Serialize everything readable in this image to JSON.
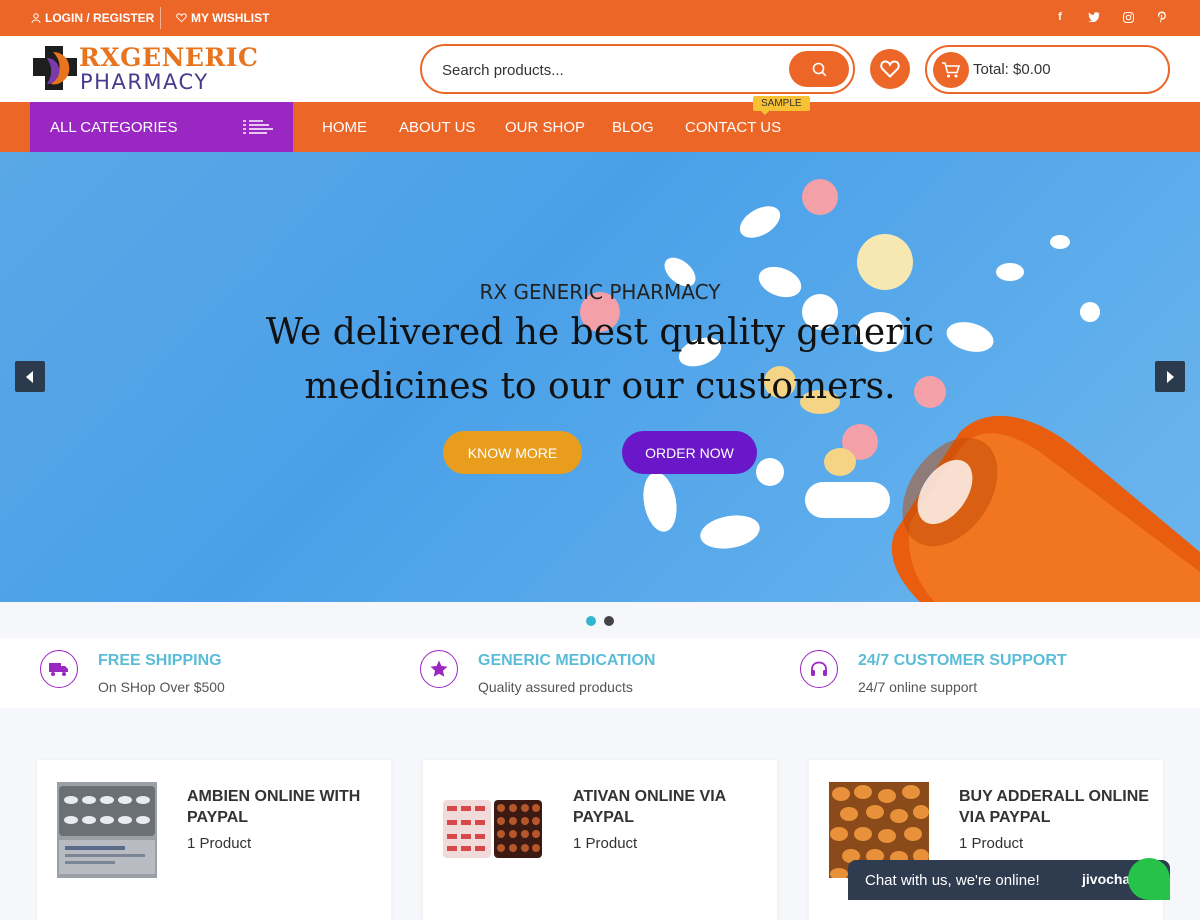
{
  "topbar": {
    "login_label": "LOGIN / REGISTER",
    "wishlist_label": "MY WISHLIST",
    "social": [
      "facebook-icon",
      "twitter-icon",
      "instagram-icon",
      "pinterest-icon"
    ]
  },
  "header": {
    "logo_line1": "RXGENERIC",
    "logo_line2": "PHARMACY",
    "search_placeholder": "Search products...",
    "cart_total": "Total: $0.00"
  },
  "nav": {
    "all_categories": "ALL CATEGORIES",
    "items": [
      "HOME",
      "ABOUT US",
      "OUR SHOP",
      "BLOG",
      "CONTACT US"
    ],
    "badge": "SAMPLE"
  },
  "hero": {
    "subtitle": "RX GENERIC PHARMACY",
    "headline_line1": "We delivered he best quality generic",
    "headline_line2": "medicines to our our customers.",
    "know_more": "KNOW MORE",
    "order_now": "ORDER NOW",
    "slide_count": 2,
    "active_slide": 1
  },
  "features": [
    {
      "title": "FREE SHIPPING",
      "subtitle": "On SHop Over $500",
      "icon": "truck-icon"
    },
    {
      "title": "GENERIC MEDICATION",
      "subtitle": "Quality assured products",
      "icon": "star-icon"
    },
    {
      "title": "24/7 CUSTOMER SUPPORT",
      "subtitle": "24/7 online support",
      "icon": "headphones-icon"
    }
  ],
  "categories": [
    {
      "title": "AMBIEN ONLINE WITH PAYPAL",
      "count": "1 Product"
    },
    {
      "title": "ATIVAN ONLINE VIA PAYPAL",
      "count": "1 Product"
    },
    {
      "title": "BUY ADDERALL ONLINE VIA PAYPAL",
      "count": "1 Product"
    }
  ],
  "chat": {
    "text": "Chat with us, we're online!",
    "brand": "jivochat"
  },
  "colors": {
    "primary": "#ec6628",
    "purple": "#9b27c3",
    "accent_teal": "#5bbcd8",
    "order_btn": "#6a17c9",
    "know_btn": "#e89d1c"
  }
}
